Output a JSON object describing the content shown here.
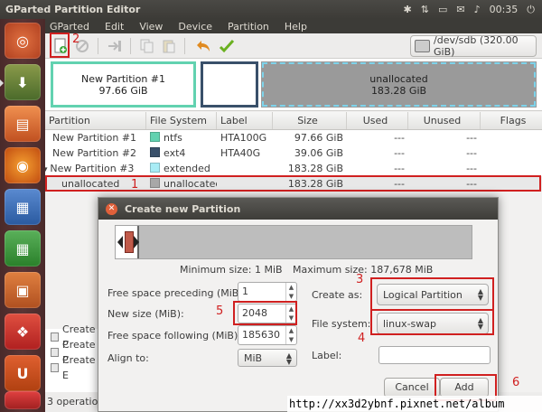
{
  "topbar": {
    "title": "GParted Partition Editor",
    "time": "00:35"
  },
  "menu": [
    "GParted",
    "Edit",
    "View",
    "Device",
    "Partition",
    "Help"
  ],
  "toolbar": {
    "device": "/dev/sdb  (320.00 GiB)"
  },
  "diskmap": {
    "seg1_name": "New Partition #1",
    "seg1_size": "97.66 GiB",
    "seg3_name": "unallocated",
    "seg3_size": "183.28 GiB"
  },
  "table": {
    "headers": [
      "Partition",
      "File System",
      "Label",
      "Size",
      "Used",
      "Unused",
      "Flags"
    ],
    "rows": [
      {
        "partition": "New Partition #1",
        "fs": "ntfs",
        "label": "HTA100G",
        "size": "97.66 GiB",
        "used": "---",
        "unused": "---",
        "flags": "",
        "color": "#62d2b0",
        "indent": 0
      },
      {
        "partition": "New Partition #2",
        "fs": "ext4",
        "label": "HTA40G",
        "size": "39.06 GiB",
        "used": "---",
        "unused": "---",
        "flags": "",
        "color": "#39506a",
        "indent": 0
      },
      {
        "partition": "New Partition #3",
        "fs": "extended",
        "label": "",
        "size": "183.28 GiB",
        "used": "---",
        "unused": "---",
        "flags": "",
        "color": "#a8ecf5",
        "indent": 0,
        "expanded": true
      },
      {
        "partition": "unallocated",
        "fs": "unallocated",
        "label": "",
        "size": "183.28 GiB",
        "used": "---",
        "unused": "---",
        "flags": "",
        "color": "#a8a8a8",
        "indent": 1
      }
    ]
  },
  "operations": [
    "Create P",
    "Create P",
    "Create E"
  ],
  "status": "3 operation",
  "dialog": {
    "title": "Create new Partition",
    "min_size": "Minimum size: 1 MiB",
    "max_size": "Maximum size: 187,678 MiB",
    "free_preceding_label": "Free space preceding (MiB):",
    "free_preceding_value": "1",
    "new_size_label": "New size (MiB):",
    "new_size_value": "2048",
    "free_following_label": "Free space following (MiB):",
    "free_following_value": "185630",
    "align_label": "Align to:",
    "align_value": "MiB",
    "create_as_label": "Create as:",
    "create_as_value": "Logical Partition",
    "filesystem_label": "File system:",
    "filesystem_value": "linux-swap",
    "label_label": "Label:",
    "label_value": "",
    "cancel": "Cancel",
    "add": "Add"
  },
  "annotations": [
    "1",
    "2",
    "3",
    "4",
    "5",
    "6"
  ],
  "watermark": "http://xx3d2ybnf.pixnet.net/album",
  "colors": {
    "ntfs": "#62d2b0",
    "ext4": "#39506a",
    "extended": "#a8ecf5",
    "unallocated": "#a8a8a8",
    "annotation": "#d02020"
  }
}
